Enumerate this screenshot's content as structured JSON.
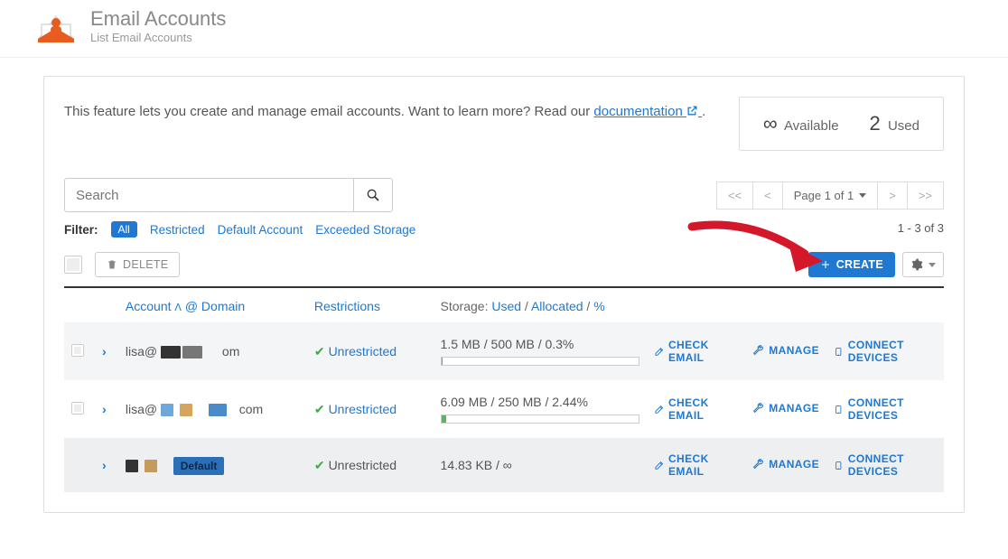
{
  "header": {
    "title": "Email Accounts",
    "subtitle": "List Email Accounts"
  },
  "intro": {
    "text_before": "This feature lets you create and manage email accounts. Want to learn more? Read our ",
    "link_text": "documentation",
    "text_after": " ."
  },
  "stats": {
    "available_symbol": "∞",
    "available_label": "Available",
    "used_value": "2",
    "used_label": "Used"
  },
  "search": {
    "placeholder": "Search"
  },
  "pager": {
    "first": "<<",
    "prev": "<",
    "page_label": "Page 1 of 1",
    "next": ">",
    "last": ">>"
  },
  "filters": {
    "label": "Filter:",
    "all": "All",
    "restricted": "Restricted",
    "default_account": "Default Account",
    "exceeded": "Exceeded Storage",
    "range": "1 - 3 of 3"
  },
  "actions": {
    "delete": "DELETE",
    "create": "CREATE"
  },
  "columns": {
    "account_prefix": "Account",
    "at": "@",
    "domain": "Domain",
    "restrictions": "Restrictions",
    "storage_prefix": "Storage: ",
    "used": "Used",
    "allocated": "Allocated",
    "percent": "%"
  },
  "row_actions": {
    "check_email": "CHECK EMAIL",
    "manage": "MANAGE",
    "connect": "CONNECT DEVICES"
  },
  "rows": [
    {
      "account_display": "lisa@",
      "domain_suffix": "om",
      "restriction": "Unrestricted",
      "restriction_link": true,
      "storage_text": "1.5 MB / 500 MB / 0.3%",
      "bar_pct": 0.3,
      "show_bar": true
    },
    {
      "account_display": "lisa@",
      "domain_suffix": "com",
      "restriction": "Unrestricted",
      "restriction_link": true,
      "storage_text": "6.09 MB / 250 MB / 2.44%",
      "bar_pct": 2.44,
      "show_bar": true
    },
    {
      "account_display": "",
      "domain_suffix": "",
      "default_badge": "Default",
      "restriction": "Unrestricted",
      "restriction_link": false,
      "storage_text": "14.83 KB / ∞",
      "show_bar": false
    }
  ]
}
